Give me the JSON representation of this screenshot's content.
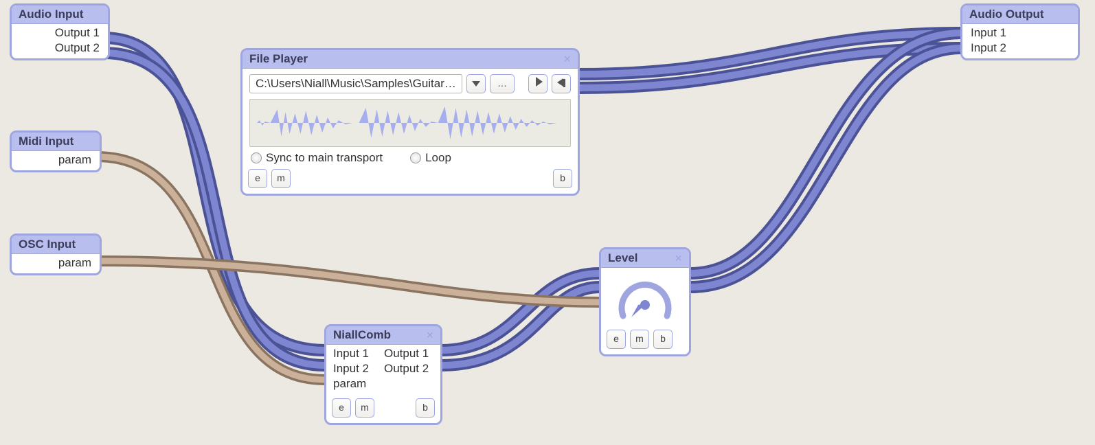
{
  "nodes": {
    "audio_input": {
      "title": "Audio Input",
      "outputs": [
        "Output 1",
        "Output 2"
      ]
    },
    "midi_input": {
      "title": "Midi Input",
      "outputs": [
        "param"
      ]
    },
    "osc_input": {
      "title": "OSC Input",
      "outputs": [
        "param"
      ]
    },
    "file_player": {
      "title": "File Player",
      "file_path": "C:\\Users\\Niall\\Music\\Samples\\Guitar…",
      "browse_label": "…",
      "options": {
        "sync": "Sync to main transport",
        "loop": "Loop"
      },
      "buttons": {
        "e": "e",
        "m": "m",
        "b": "b"
      }
    },
    "niall_comb": {
      "title": "NiallComb",
      "inputs": [
        "Input 1",
        "Input 2",
        "param"
      ],
      "outputs": [
        "Output 1",
        "Output 2"
      ],
      "buttons": {
        "e": "e",
        "m": "m",
        "b": "b"
      }
    },
    "level": {
      "title": "Level",
      "buttons": {
        "e": "e",
        "m": "m",
        "b": "b"
      }
    },
    "audio_output": {
      "title": "Audio Output",
      "inputs": [
        "Input 1",
        "Input 2"
      ]
    }
  },
  "cables": [
    {
      "kind": "audio",
      "from": "audio_input.Output 1",
      "to": "niall_comb.Input 1"
    },
    {
      "kind": "audio",
      "from": "audio_input.Output 2",
      "to": "niall_comb.Input 2"
    },
    {
      "kind": "audio",
      "from": "file_player.out 1",
      "to": "audio_output.Input 1"
    },
    {
      "kind": "audio",
      "from": "file_player.out 2",
      "to": "audio_output.Input 2"
    },
    {
      "kind": "audio",
      "from": "niall_comb.Output 1",
      "to": "level.in 1"
    },
    {
      "kind": "audio",
      "from": "niall_comb.Output 2",
      "to": "level.in 2"
    },
    {
      "kind": "audio",
      "from": "level.out 1",
      "to": "audio_output.Input 1"
    },
    {
      "kind": "audio",
      "from": "level.out 2",
      "to": "audio_output.Input 2"
    },
    {
      "kind": "param",
      "from": "midi_input.param",
      "to": "niall_comb.param"
    },
    {
      "kind": "param",
      "from": "osc_input.param",
      "to": "level.param"
    }
  ],
  "colors": {
    "audio_cable": "#6f77c9",
    "param_cable": "#c3a189",
    "node_border": "#9ea5df",
    "titlebar": "#b8bfef",
    "background": "#ebe9e1"
  }
}
